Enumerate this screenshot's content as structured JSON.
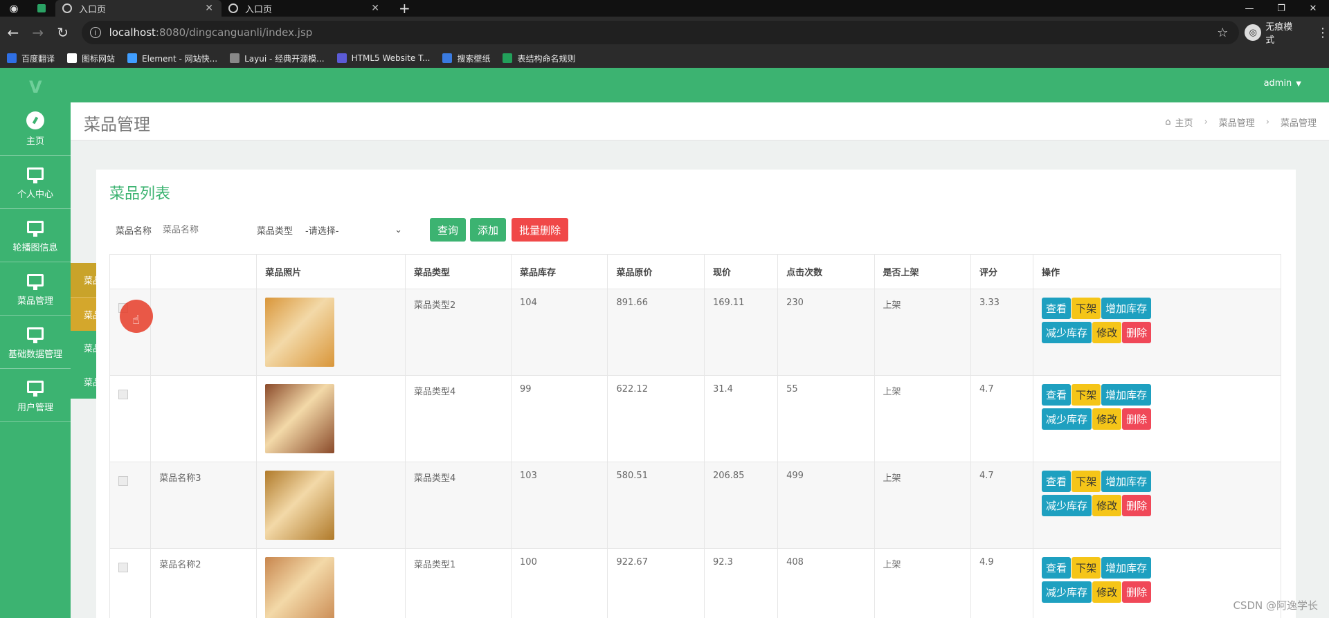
{
  "browser": {
    "tabs": [
      {
        "label": "入口页",
        "active": true
      },
      {
        "label": "入口页",
        "active": false
      }
    ],
    "new_tab": "+",
    "url_host": "localhost",
    "url_path": ":8080/dingcanguanli/index.jsp",
    "incognito_label": "无痕模式",
    "bookmarks": [
      {
        "label": "百度翻译",
        "color": "#2f6fe4"
      },
      {
        "label": "图标网站",
        "color": "#ffffff"
      },
      {
        "label": "Element - 网站快...",
        "color": "#409eff"
      },
      {
        "label": "Layui - 经典开源模...",
        "color": "#888888"
      },
      {
        "label": "HTML5 Website T...",
        "color": "#5b5bd6"
      },
      {
        "label": "搜索壁纸",
        "color": "#3a7be0"
      },
      {
        "label": "表结构命名规则",
        "color": "#22a05a"
      }
    ]
  },
  "header": {
    "logo": "V",
    "user": "admin"
  },
  "sidebar": {
    "items": [
      {
        "label": "主页",
        "icon": "dashboard-icon"
      },
      {
        "label": "个人中心",
        "icon": "monitor-icon"
      },
      {
        "label": "轮播图信息",
        "icon": "monitor-icon"
      },
      {
        "label": "菜品管理",
        "icon": "monitor-icon"
      },
      {
        "label": "基础数据管理",
        "icon": "monitor-icon"
      },
      {
        "label": "用户管理",
        "icon": "monitor-icon"
      }
    ],
    "submenu": [
      "菜品管理",
      "菜品评价管理",
      "菜品收藏管理",
      "菜品订单管理"
    ]
  },
  "page": {
    "title": "菜品管理",
    "breadcrumb": [
      "主页",
      "菜品管理",
      "菜品管理"
    ]
  },
  "panel": {
    "title": "菜品列表",
    "filters": {
      "name_label": "菜品名称",
      "name_placeholder": "菜品名称",
      "type_label": "菜品类型",
      "type_selected": "-请选择-"
    },
    "buttons": {
      "search": "查询",
      "add": "添加",
      "batch_delete": "批量删除"
    }
  },
  "table": {
    "headers": [
      "",
      "",
      "菜品照片",
      "菜品类型",
      "菜品库存",
      "菜品原价",
      "现价",
      "点击次数",
      "是否上架",
      "评分",
      "操作"
    ],
    "rows": [
      {
        "name": "",
        "type": "菜品类型2",
        "stock": "104",
        "orig": "891.66",
        "price": "169.11",
        "clicks": "230",
        "status": "上架",
        "rating": "3.33",
        "img": "#d9963a"
      },
      {
        "name": "",
        "type": "菜品类型4",
        "stock": "99",
        "orig": "622.12",
        "price": "31.4",
        "clicks": "55",
        "status": "上架",
        "rating": "4.7",
        "img": "#8a4a2a"
      },
      {
        "name": "菜品名称3",
        "type": "菜品类型4",
        "stock": "103",
        "orig": "580.51",
        "price": "206.85",
        "clicks": "499",
        "status": "上架",
        "rating": "4.7",
        "img": "#b07a2a"
      },
      {
        "name": "菜品名称2",
        "type": "菜品类型1",
        "stock": "100",
        "orig": "922.67",
        "price": "92.3",
        "clicks": "408",
        "status": "上架",
        "rating": "4.9",
        "img": "#c8864e"
      }
    ],
    "actions": {
      "view": "查看",
      "offshelf": "下架",
      "add_stock": "增加库存",
      "reduce_stock": "减少库存",
      "edit": "修改",
      "delete": "删除"
    }
  },
  "watermark": "CSDN @阿逸学长"
}
